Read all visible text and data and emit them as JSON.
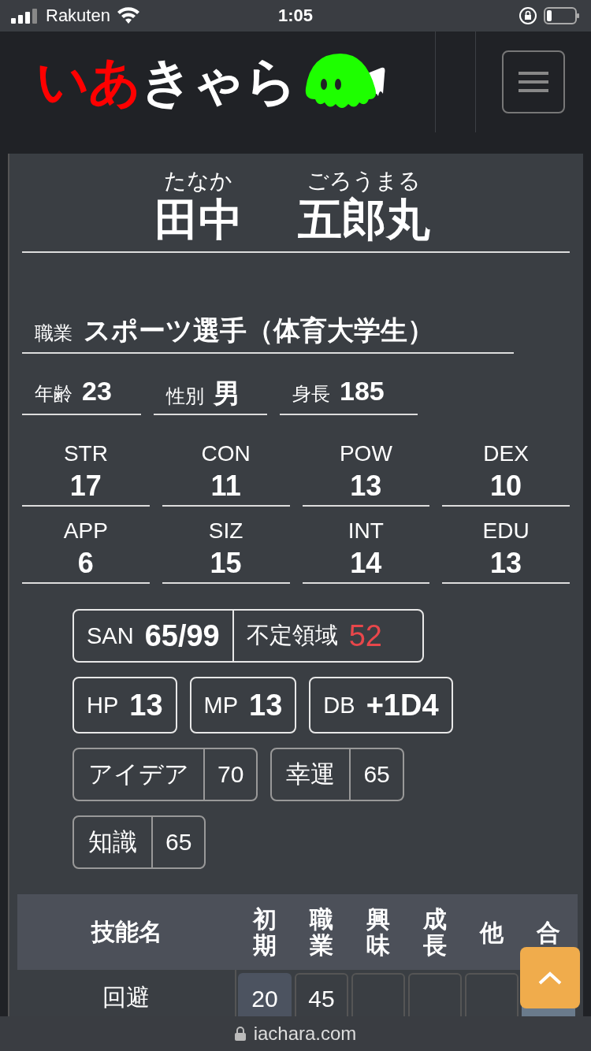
{
  "status_bar": {
    "carrier": "Rakuten",
    "time": "1:05"
  },
  "header": {
    "logo": [
      {
        "text": "いあ",
        "color": "#ff0000"
      },
      {
        "text": "きゃら",
        "color": "#ffffff"
      }
    ]
  },
  "character": {
    "names": [
      {
        "furigana": "たなか",
        "name": "田中"
      },
      {
        "furigana": "ごろうまる",
        "name": "五郎丸"
      }
    ]
  },
  "profile": {
    "occupation": {
      "label": "職業",
      "value": "スポーツ選手（体育大学生）"
    },
    "attributes": [
      {
        "label": "年齢",
        "value": "23"
      },
      {
        "label": "性別",
        "value": "男"
      },
      {
        "label": "身長",
        "value": "185"
      }
    ]
  },
  "stats": [
    {
      "label": "STR",
      "value": "17"
    },
    {
      "label": "CON",
      "value": "11"
    },
    {
      "label": "POW",
      "value": "13"
    },
    {
      "label": "DEX",
      "value": "10"
    },
    {
      "label": "APP",
      "value": "6"
    },
    {
      "label": "SIZ",
      "value": "15"
    },
    {
      "label": "INT",
      "value": "14"
    },
    {
      "label": "EDU",
      "value": "13"
    }
  ],
  "san": {
    "label": "SAN",
    "value": "65/99",
    "indefinite_label": "不定領域",
    "indefinite_value": "52"
  },
  "derived": [
    {
      "label": "HP",
      "value": "13"
    },
    {
      "label": "MP",
      "value": "13"
    },
    {
      "label": "DB",
      "value": "+1D4"
    }
  ],
  "rolls": [
    {
      "label": "アイデア",
      "value": "70"
    },
    {
      "label": "幸運",
      "value": "65"
    },
    {
      "label": "知識",
      "value": "65"
    }
  ],
  "skills_table": {
    "columns": [
      "技能名",
      "初期",
      "職業",
      "興味",
      "成長",
      "他",
      "合"
    ],
    "rows": [
      {
        "cells": [
          {
            "kind": "name",
            "value": "回避"
          },
          {
            "kind": "base",
            "value": "20"
          },
          {
            "kind": "input",
            "value": "45"
          },
          {
            "kind": "input"
          },
          {
            "kind": "input"
          },
          {
            "kind": "input"
          },
          {
            "kind": "total"
          }
        ]
      }
    ]
  },
  "browser": {
    "url": "iachara.com"
  }
}
